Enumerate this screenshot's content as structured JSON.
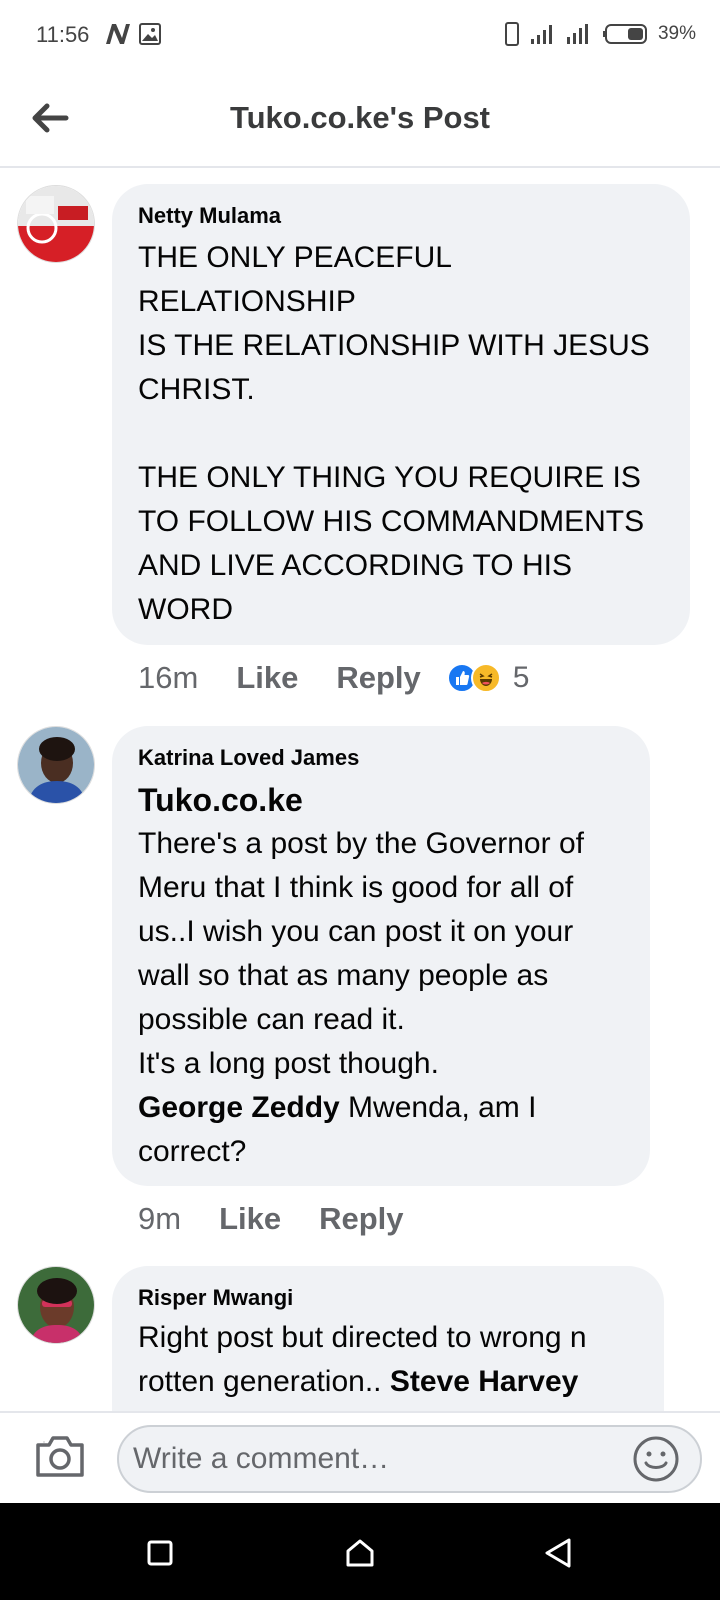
{
  "status_bar": {
    "time": "11:56",
    "battery": "39%",
    "icons": [
      "n-icon",
      "image-icon",
      "phone-icon",
      "signal-icon",
      "signal-icon",
      "battery-icon"
    ]
  },
  "header": {
    "title": "Tuko.co.ke's Post",
    "back_icon": "arrow-left-icon"
  },
  "comments": [
    {
      "author": "Netty Mulama",
      "lines": "THE ONLY PEACEFUL\nRELATIONSHIP\nIS THE RELATIONSHIP WITH JESUS\nCHRIST.\n\nTHE ONLY THING YOU REQUIRE IS\nTO FOLLOW HIS COMMANDMENTS\nAND LIVE ACCORDING TO HIS\nWORD",
      "time": "16m",
      "like": "Like",
      "reply": "Reply",
      "reaction_count": "5",
      "reactions": [
        "like-reaction-icon",
        "haha-reaction-icon"
      ]
    },
    {
      "author": "Katrina Loved James",
      "page_tag": "Tuko.co.ke",
      "lines": "There's a post by the Governor of\nMeru that I think is good for all of\nus..I wish you can post it on your\nwall so that as many people as\npossible can read it.\nIt's a long post though.",
      "mention": "George Zeddy",
      "after_mention_1": " Mwenda, am I",
      "after_mention_2": "correct?",
      "time": "9m",
      "like": "Like",
      "reply": "Reply"
    },
    {
      "author": "Risper Mwangi",
      "line1": "Right post but directed to wrong n",
      "line2_start": "rotten generation.. ",
      "line2_mention": "Steve Harvey"
    }
  ],
  "composer": {
    "placeholder": "Write a comment…",
    "camera_icon": "camera-icon",
    "emoji_icon": "emoji-icon"
  },
  "colors": {
    "bubble": "#f0f2f5",
    "secondary_text": "#65676b",
    "like_blue": "#1877f2",
    "haha_yellow": "#f7b928"
  }
}
